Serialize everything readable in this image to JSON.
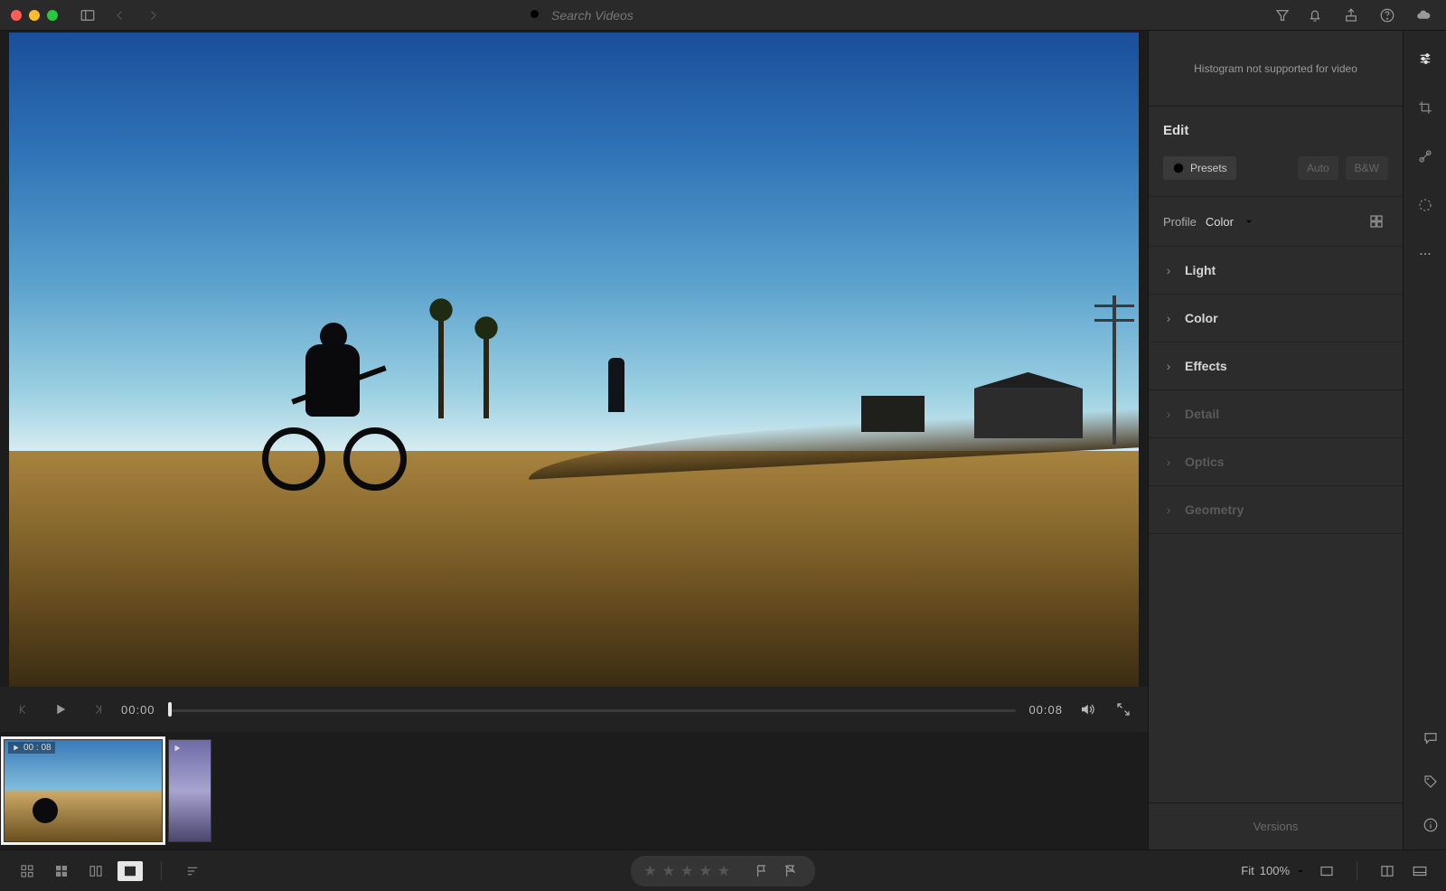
{
  "topbar": {
    "search_placeholder": "Search Videos"
  },
  "playback": {
    "current_time": "00:00",
    "duration": "00:08"
  },
  "filmstrip": {
    "thumb1_label": "00 : 08"
  },
  "panel": {
    "histogram_note": "Histogram not supported for video",
    "edit_title": "Edit",
    "presets_label": "Presets",
    "auto_label": "Auto",
    "bw_label": "B&W",
    "profile_label": "Profile",
    "profile_value": "Color",
    "sections": {
      "light": "Light",
      "color": "Color",
      "effects": "Effects",
      "detail": "Detail",
      "optics": "Optics",
      "geometry": "Geometry"
    },
    "versions_label": "Versions"
  },
  "bottombar": {
    "fit_label": "Fit",
    "zoom_value": "100%"
  }
}
